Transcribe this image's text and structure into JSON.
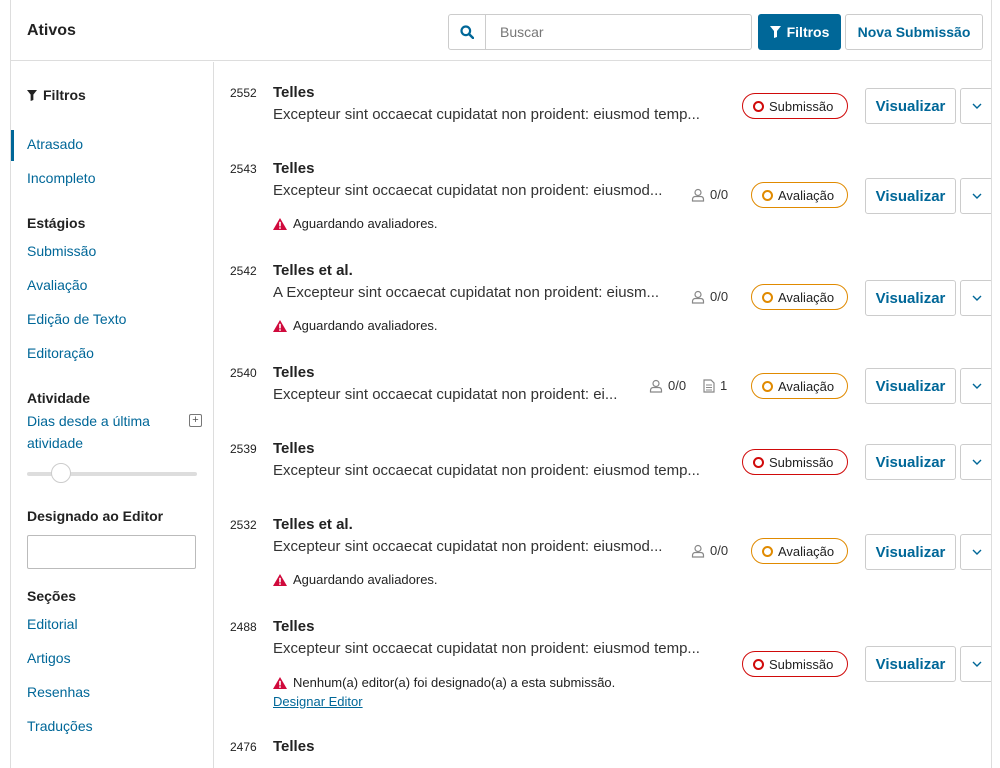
{
  "header": {
    "title": "Ativos",
    "search_placeholder": "Buscar",
    "filters_label": "Filtros",
    "new_submission_label": "Nova Submissão"
  },
  "sidebar": {
    "filters_heading": "Filtros",
    "quick": [
      "Atrasado",
      "Incompleto"
    ],
    "stages_heading": "Estágios",
    "stages": [
      "Submissão",
      "Avaliação",
      "Edição de Texto",
      "Editoração"
    ],
    "activity_heading": "Atividade",
    "activity_link": "Dias desde a última atividade",
    "assigned_heading": "Designado ao Editor",
    "sections_heading": "Seções",
    "sections": [
      "Editorial",
      "Artigos",
      "Resenhas",
      "Traduções"
    ]
  },
  "list": {
    "view_label": "Visualizar",
    "items": [
      {
        "id": "2552",
        "author": "Telles",
        "title": "Excepteur sint occaecat cupidatat non proident: eiusmod temp...",
        "stage": "Submissão"
      },
      {
        "id": "2543",
        "author": "Telles",
        "title": "Excepteur sint occaecat cupidatat non proident: eiusmod...",
        "stage": "Avaliação",
        "reviews": "0/0",
        "warning": "Aguardando avaliadores."
      },
      {
        "id": "2542",
        "author": "Telles et al.",
        "title": "A Excepteur sint occaecat cupidatat non proident: eiusm...",
        "stage": "Avaliação",
        "reviews": "0/0",
        "warning": "Aguardando avaliadores."
      },
      {
        "id": "2540",
        "author": "Telles",
        "title": "Excepteur sint occaecat cupidatat non proident: ei...",
        "stage": "Avaliação",
        "reviews": "0/0",
        "files": "1"
      },
      {
        "id": "2539",
        "author": "Telles",
        "title": "Excepteur sint occaecat cupidatat non proident: eiusmod temp...",
        "stage": "Submissão"
      },
      {
        "id": "2532",
        "author": "Telles et al.",
        "title": "Excepteur sint occaecat cupidatat non proident: eiusmod...",
        "stage": "Avaliação",
        "reviews": "0/0",
        "warning": "Aguardando avaliadores."
      },
      {
        "id": "2488",
        "author": "Telles",
        "title": "Excepteur sint occaecat cupidatat non proident: eiusmod temp...",
        "stage": "Submissão",
        "warning": "Nenhum(a) editor(a) foi designado(a) a esta submissão.",
        "warning_link": "Designar Editor"
      },
      {
        "id": "2476",
        "author": "Telles"
      }
    ]
  },
  "colors": {
    "accent": "#006798",
    "submission": "#d00a0a",
    "review": "#e08a00",
    "warning": "#d00a3c"
  }
}
